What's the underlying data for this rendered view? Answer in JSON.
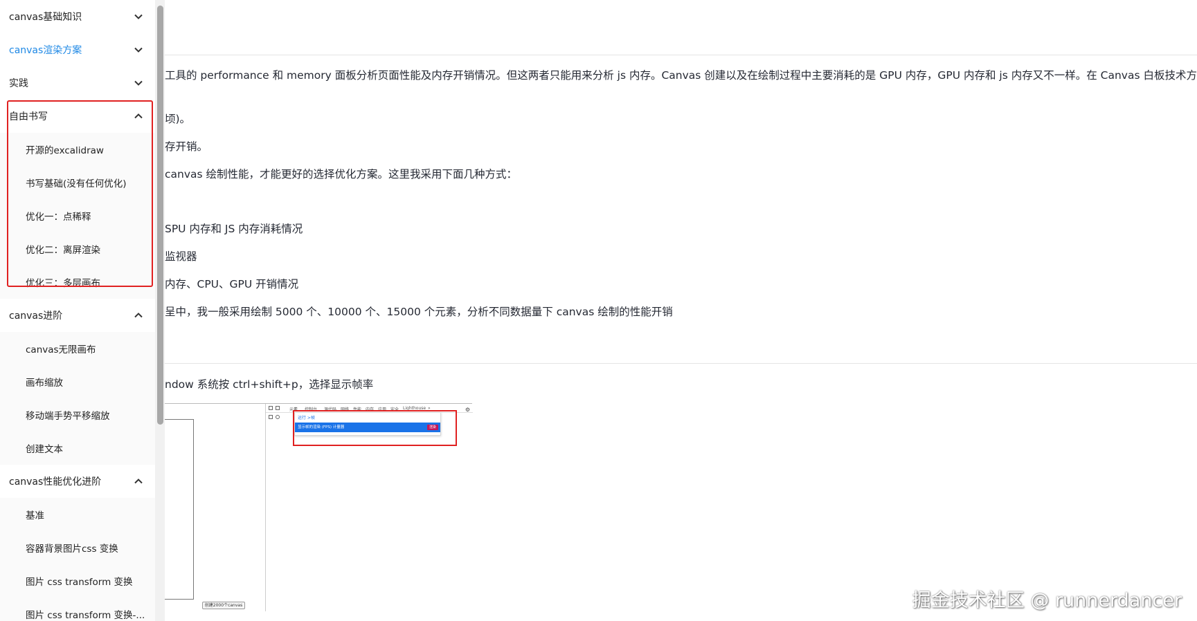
{
  "sidebar": {
    "groups": [
      {
        "label": "canvas基础知识",
        "expanded": false,
        "active": false,
        "items": []
      },
      {
        "label": "canvas渲染方案",
        "expanded": false,
        "active": true,
        "items": []
      },
      {
        "label": "实践",
        "expanded": false,
        "active": false,
        "items": []
      },
      {
        "label": "自由书写",
        "expanded": true,
        "active": false,
        "items": [
          "开源的excalidraw",
          "书写基础(没有任何优化)",
          "优化一：点稀释",
          "优化二：离屏渲染",
          "优化三：多层画布"
        ]
      },
      {
        "label": "canvas进阶",
        "expanded": true,
        "active": false,
        "items": [
          "canvas无限画布",
          "画布缩放",
          "移动端手势平移缩放",
          "创建文本"
        ]
      },
      {
        "label": "canvas性能优化进阶",
        "expanded": true,
        "active": false,
        "items": [
          "基准",
          "容器背景图片css 变换",
          "图片 css transform 变换",
          "图片 css transform 变换-..."
        ]
      }
    ]
  },
  "article": {
    "paragraphs": [
      "工具的 performance 和 memory 面板分析页面性能及内存开销情况。但这两者只能用来分析 js 内存。Canvas 创建以及在绘制过程中主要消耗的是 GPU 内存，GPU 内存和 js 内存又不一样。在 Canvas 白板技术方案",
      "顷)。",
      "存开销。",
      "canvas 绘制性能，才能更好的选择优化方案。这里我采用下面几种方式：",
      "SPU 内存和 JS 内存消耗情况",
      "监视器",
      "内存、CPU、GPU 开销情况",
      "呈中，我一般采用绘制 5000 个、10000 个、15000 个元素，分析不同数据量下 canvas 绘制的性能开销",
      "ndow 系统按 ctrl+shift+p，选择显示帧率"
    ],
    "screenshot": {
      "devtools_tabs": [
        "元素",
        "控制台",
        "源代码",
        "网络",
        "性能",
        "内存",
        "应用",
        "安全",
        "Lighthouse",
        "»"
      ],
      "command_input": "运行 >帧",
      "command_result": "显示帧的渲染 (FPS) 计量器",
      "command_badge": "渲染",
      "canvas_button": "创建2000个canvas"
    }
  },
  "watermark": "掘金技术社区 @ runnerdancer"
}
